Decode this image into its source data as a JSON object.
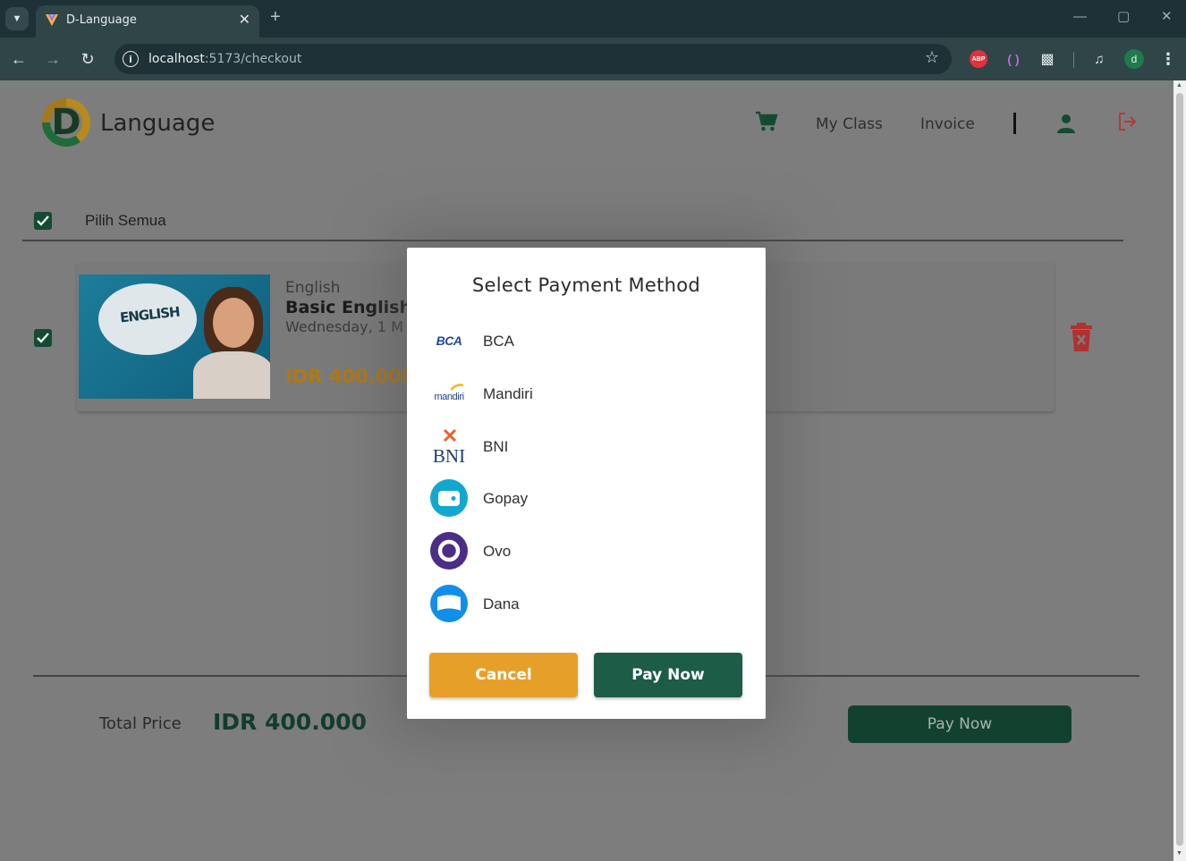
{
  "browser": {
    "tab_title": "D-Language",
    "url_host": "localhost",
    "url_path": ":5173/checkout",
    "profile_initial": "d",
    "extension_abp": "ABP"
  },
  "header": {
    "logo_letter": "D",
    "logo_text": "Language",
    "nav": {
      "cart_icon": "cart-icon",
      "my_class": "My Class",
      "invoice": "Invoice",
      "user_icon": "user-icon",
      "logout_icon": "logout-icon"
    }
  },
  "cart": {
    "select_all_label": "Pilih Semua",
    "select_all_checked": true,
    "items": [
      {
        "checked": true,
        "image_text": "ENGLISH",
        "category": "English",
        "title": "Basic English",
        "schedule": "Wednesday, 1 M",
        "price": "IDR 400.000"
      }
    ]
  },
  "summary": {
    "total_label": "Total Price",
    "total_value": "IDR 400.000",
    "pay_button": "Pay Now"
  },
  "modal": {
    "title": "Select Payment Method",
    "methods": [
      {
        "label": "BCA",
        "logo_text": "BCA"
      },
      {
        "label": "Mandiri",
        "logo_text": "mandiri"
      },
      {
        "label": "BNI",
        "logo_text": "BNI"
      },
      {
        "label": "Gopay"
      },
      {
        "label": "Ovo"
      },
      {
        "label": "Dana"
      }
    ],
    "cancel_button": "Cancel",
    "pay_button": "Pay Now"
  },
  "colors": {
    "brand_green": "#1d5c47",
    "accent_orange": "#e6a02a",
    "price_gold": "#b07915",
    "delete_red": "#c0392b"
  }
}
